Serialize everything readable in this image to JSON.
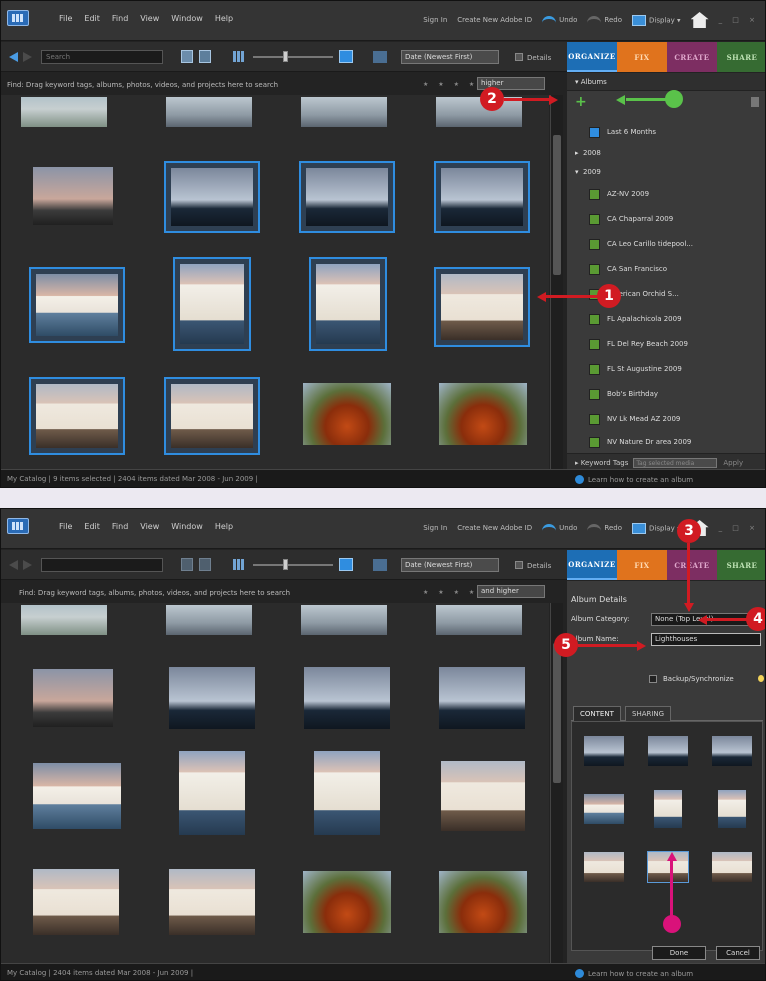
{
  "menu": {
    "items": [
      "File",
      "Edit",
      "Find",
      "View",
      "Window",
      "Help"
    ],
    "sign_in": "Sign In",
    "create_id": "Create New Adobe ID",
    "undo": "Undo",
    "redo": "Redo",
    "display": "Display",
    "window_controls": "_ □ ×"
  },
  "toolbar": {
    "search_placeholder": "Search",
    "sort": "Date (Newest First)",
    "details": "Details"
  },
  "tabs": {
    "organize": "ORGANIZE",
    "fix": "FIX",
    "create": "CREATE",
    "share": "SHARE"
  },
  "hint": "Find: Drag keyword tags, albums, photos, videos, and projects here to search",
  "rating": {
    "stars": "★ ★ ★ ★ ★",
    "mode_s1": "higher",
    "mode_s2": "and higher"
  },
  "screen1": {
    "albums_header": "Albums",
    "last_months": "Last 6 Months",
    "year_2008": "2008",
    "year_2009": "2009",
    "albums": [
      "AZ-NV 2009",
      "CA Chaparral 2009",
      "CA Leo Carillo tidepool...",
      "CA San Francisco",
      "American Orchid S...",
      "FL Apalachicola 2009",
      "FL Del Rey Beach 2009",
      "FL St Augustine 2009",
      "Bob's Birthday",
      "NV Lk Mead AZ 2009",
      "NV Nature Dr area 2009"
    ],
    "keyword_tags": "Keyword Tags",
    "tag_placeholder": "Tag selected media",
    "apply": "Apply",
    "status": "My Catalog  |  9 items selected  |  2404 items dated Mar 2008 - Jun 2009  |",
    "learn": "Learn how to create an album"
  },
  "screen2": {
    "details_header": "Album Details",
    "category_label": "Album Category:",
    "category_value": "None (Top Level)",
    "name_label": "Album Name:",
    "name_value": "Lighthouses",
    "backup": "Backup/Synchronize",
    "tab_content": "CONTENT",
    "tab_sharing": "SHARING",
    "done": "Done",
    "cancel": "Cancel",
    "status": "My Catalog  |  2404 items dated Mar 2008 - Jun 2009  |",
    "learn": "Learn how to create an album"
  },
  "callouts": [
    "1",
    "2",
    "3",
    "4",
    "5"
  ],
  "colors": {
    "accent": "#2f8de0",
    "callout": "#d11b22",
    "pink": "#d9127a",
    "green": "#5ac24a"
  },
  "icons": [
    "app-logo-icon",
    "undo-icon",
    "redo-icon",
    "display-icon",
    "home-icon",
    "back-icon",
    "forward-icon",
    "add-album-icon",
    "trash-icon",
    "lightbulb-icon"
  ]
}
